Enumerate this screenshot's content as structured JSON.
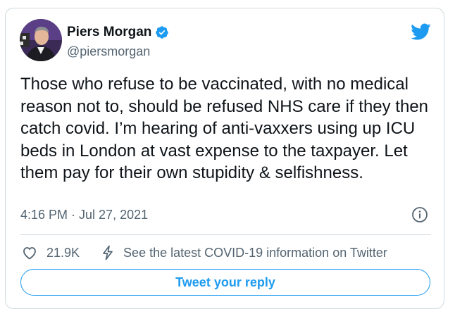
{
  "tweet": {
    "author": {
      "display_name": "Piers Morgan",
      "handle": "@piersmorgan",
      "verified": true
    },
    "text": "Those who refuse to be vaccinated, with no medical reason not to, should be refused NHS care if they then catch covid. I’m hearing of anti-vaxxers using up ICU beds in London at vast expense to the taxpayer. Let them pay for their own stupidity & selfishness.",
    "timestamp": "4:16 PM · Jul 27, 2021",
    "likes": "21.9K",
    "covid_link": "See the latest COVID-19 information on Twitter",
    "reply_button": "Tweet your reply"
  },
  "icons": {
    "verified": "verified-badge-icon",
    "brand": "twitter-bird-icon",
    "info": "info-icon",
    "like": "heart-icon",
    "covid": "lightning-icon"
  },
  "colors": {
    "brand_blue": "#1d9bf0",
    "secondary_text": "#536471",
    "border": "#cfd9de"
  }
}
